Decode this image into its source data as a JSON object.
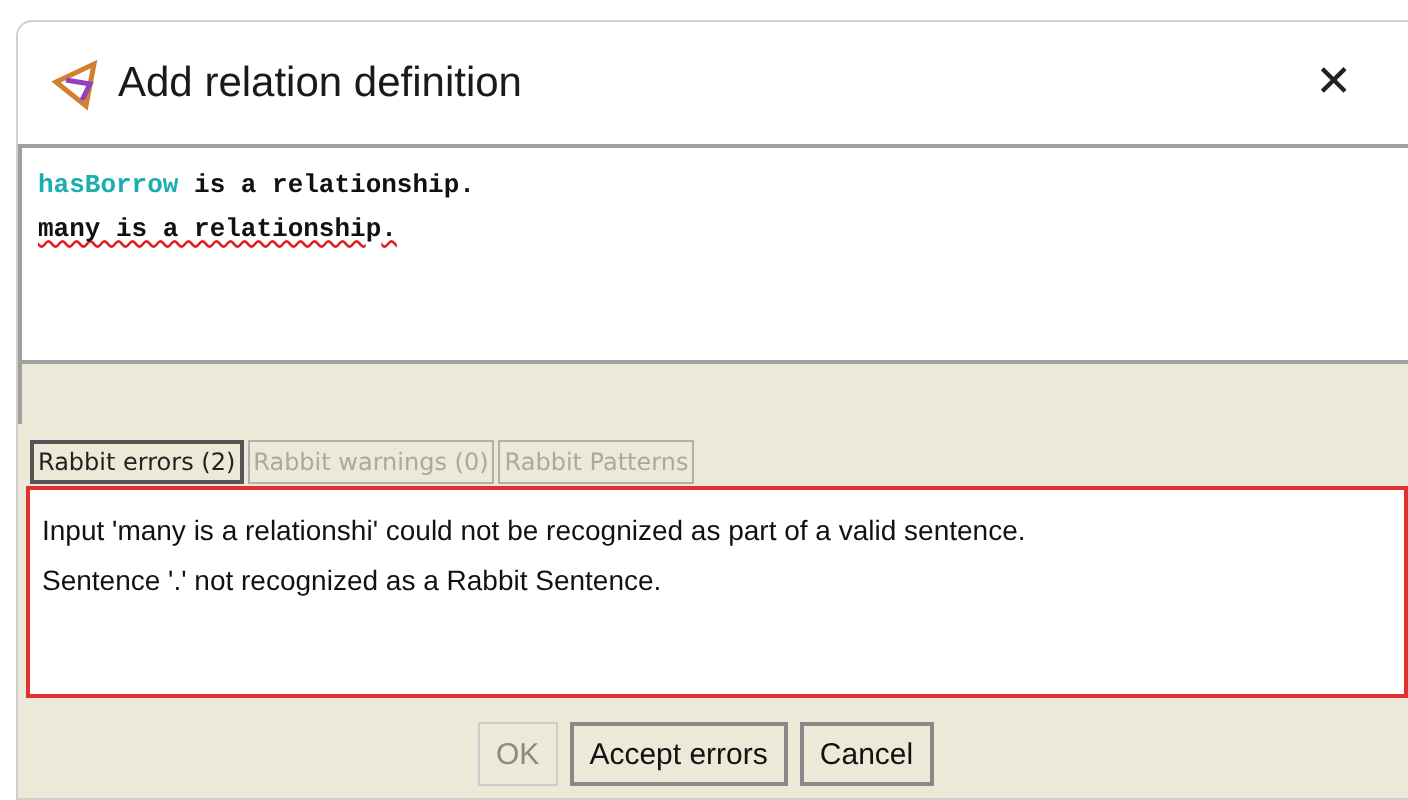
{
  "window": {
    "title": "Add relation definition",
    "close": "✕"
  },
  "editor": {
    "lines": [
      [
        {
          "text": "hasBorrow",
          "kind": "concept"
        },
        {
          "text": " is a relationship.",
          "kind": "plain"
        }
      ],
      [
        {
          "text": "many is a relationshi",
          "kind": "error"
        },
        {
          "text": "p",
          "kind": "plain"
        },
        {
          "text": ".",
          "kind": "error"
        }
      ]
    ]
  },
  "tabs": [
    {
      "label": "Rabbit errors (2)",
      "selected": true
    },
    {
      "label": "Rabbit warnings (0)",
      "selected": false
    },
    {
      "label": "Rabbit Patterns",
      "selected": false
    }
  ],
  "messages": [
    "Input 'many is a relationshi' could not be recognized as part of a valid sentence.",
    "Sentence '.' not recognized as a Rabbit Sentence."
  ],
  "buttons": [
    {
      "label": "OK",
      "disabled": true
    },
    {
      "label": "Accept errors",
      "disabled": false
    },
    {
      "label": "Cancel",
      "disabled": false
    }
  ]
}
